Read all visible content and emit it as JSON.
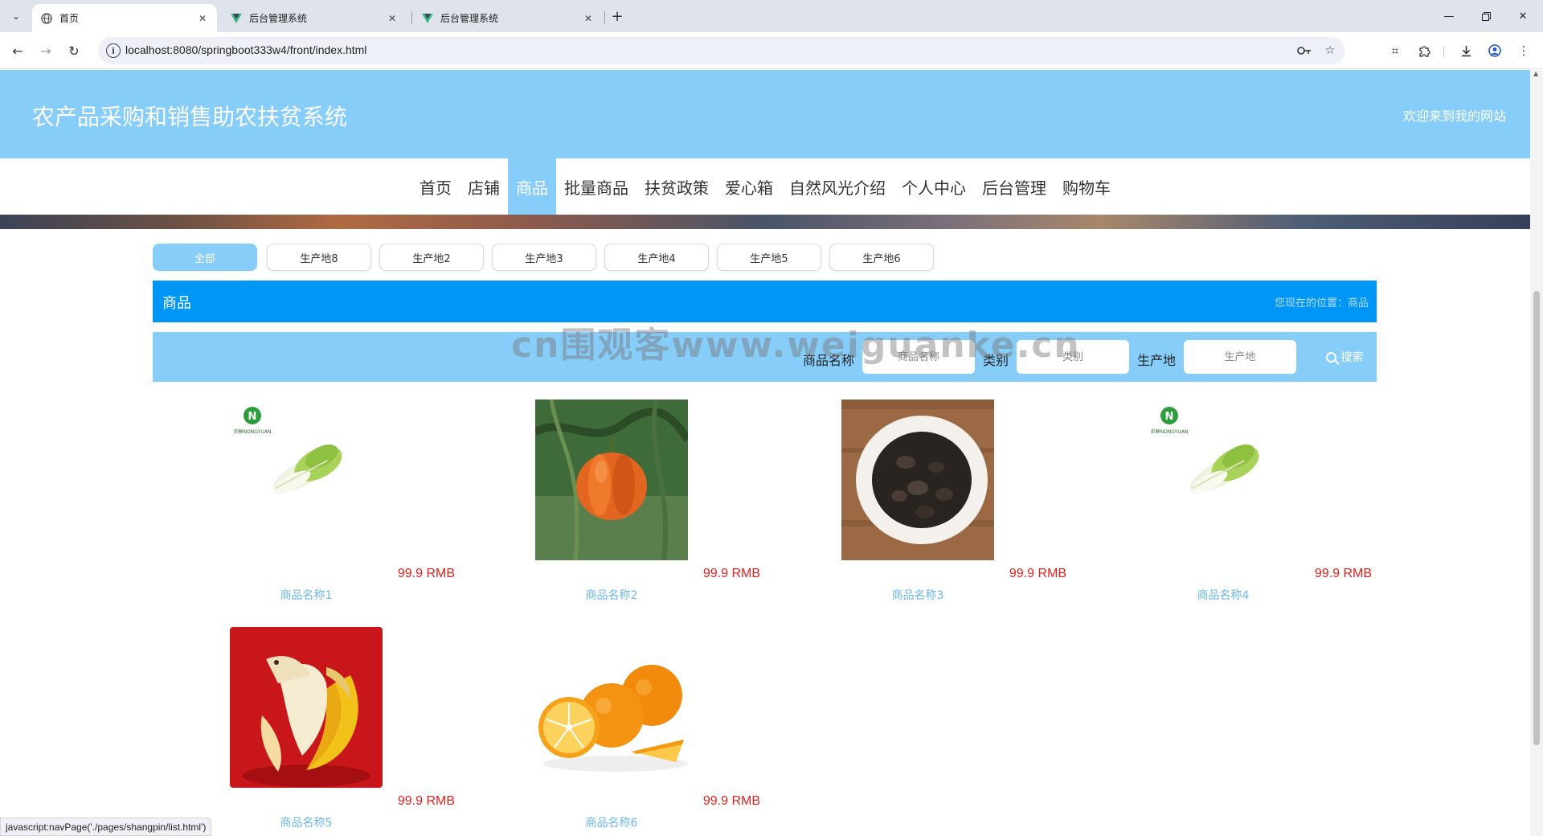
{
  "browser": {
    "tabs": [
      {
        "title": "首页",
        "icon": "globe-icon"
      },
      {
        "title": "后台管理系统",
        "icon": "vue-logo-icon"
      },
      {
        "title": "后台管理系统",
        "icon": "vue-logo-icon"
      }
    ],
    "url": "localhost:8080/springboot333w4/front/index.html",
    "status_text": "javascript:navPage('./pages/shangpin/list.html')"
  },
  "site": {
    "title": "农产品采购和销售助农扶贫系统",
    "welcome": "欢迎来到我的网站",
    "accent_color": "#87cdf9",
    "section_color": "#0096f5"
  },
  "nav": {
    "items": [
      "首页",
      "店铺",
      "商品",
      "批量商品",
      "扶贫政策",
      "爱心箱",
      "自然风光介绍",
      "个人中心",
      "后台管理",
      "购物车"
    ],
    "active_index": 2
  },
  "filters": {
    "items": [
      "全部",
      "生产地8",
      "生产地2",
      "生产地3",
      "生产地4",
      "生产地5",
      "生产地6"
    ],
    "active_index": 0
  },
  "section": {
    "title": "商品",
    "breadcrumb": "您现在的位置：商品"
  },
  "search": {
    "name_label": "商品名称",
    "name_placeholder": "商品名称",
    "category_label": "类别",
    "category_placeholder": "类别",
    "origin_label": "生产地",
    "origin_placeholder": "生产地",
    "button_label": "搜索"
  },
  "products": [
    {
      "name": "商品名称1",
      "price": "99.9 RMB",
      "image": "cabbage"
    },
    {
      "name": "商品名称2",
      "price": "99.9 RMB",
      "image": "pumpkin"
    },
    {
      "name": "商品名称3",
      "price": "99.9 RMB",
      "image": "black-beans"
    },
    {
      "name": "商品名称4",
      "price": "99.9 RMB",
      "image": "cabbage"
    },
    {
      "name": "商品名称5",
      "price": "99.9 RMB",
      "image": "banana"
    },
    {
      "name": "商品名称6",
      "price": "99.9 RMB",
      "image": "oranges"
    }
  ],
  "product_logo_text": "农鲜NONGYUAN",
  "watermark": "cn围观客www.weiguanke.cn"
}
